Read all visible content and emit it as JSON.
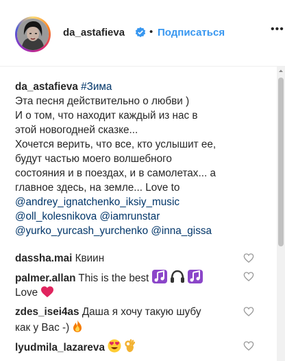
{
  "post": {
    "username": "da_astafieva",
    "separator": "•",
    "follow_label": "Подписаться",
    "more_label": "•••",
    "verified_icon": "verified-badge-icon",
    "colors": {
      "accent": "#3897f0",
      "link": "#003569",
      "text": "#262626",
      "heart": "#ed4956"
    }
  },
  "caption": {
    "username": "da_astafieva",
    "hashtag": "#Зима",
    "lines": [
      "Эта песня действительно о любви )",
      "И о том, что находит каждый из нас в",
      "этой новогодней сказке...",
      "Хочется верить, что все, кто услышит ее,",
      "будут частью моего волшебного",
      "состояния и в поездах, и в самолетах... а",
      "главное здесь, на земле... Love to"
    ],
    "mentions": [
      "@andrey_ignatchenko_iksiy_music",
      "@oll_kolesnikova",
      "@iamrunstar",
      "@yurko_yurcash_yurchenko",
      "@inna_gissa"
    ]
  },
  "comments": [
    {
      "username": "dassha.mai",
      "text": "Квиин",
      "emoji": []
    },
    {
      "username": "palmer.allan",
      "text": "This is the best",
      "text2": "Love",
      "emoji": [
        "music-notes",
        "headphones",
        "music-notes",
        "red-heart"
      ]
    },
    {
      "username": "zdes_isei4as",
      "text": "Даша я хочу такую шубу",
      "text2": "как у Вас -)",
      "emoji": [
        "fire"
      ]
    },
    {
      "username": "lyudmila_lazareva",
      "text": "",
      "emoji": [
        "heart-eyes",
        "ok-hand"
      ]
    }
  ]
}
